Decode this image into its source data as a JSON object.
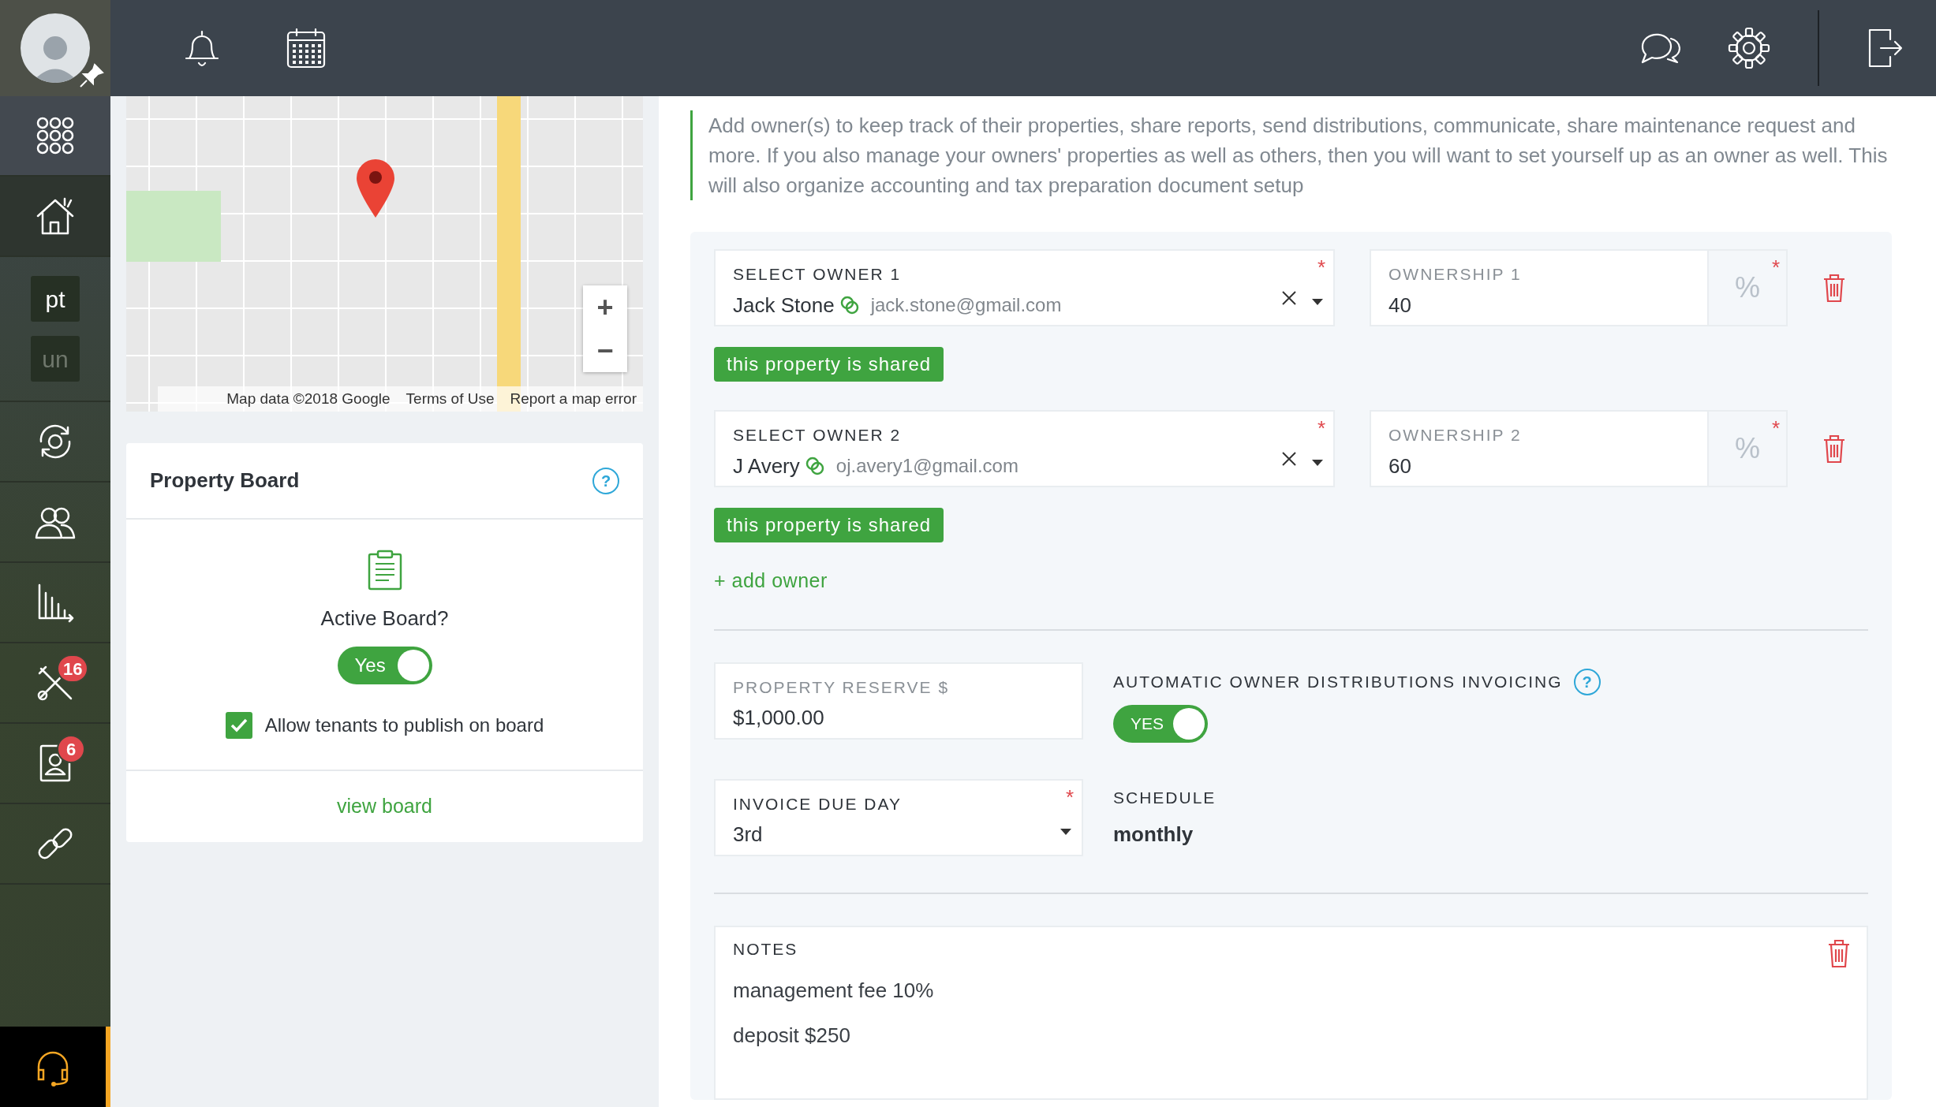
{
  "sidebar": {
    "avatar": {
      "pinned": true
    },
    "items": [
      {
        "kind": "icon",
        "selected": false
      },
      {
        "kind": "icon",
        "selected": true
      },
      {
        "kind": "text",
        "label": "pt",
        "selected": true
      },
      {
        "kind": "text",
        "label": "un",
        "selected": false
      },
      {
        "kind": "icon",
        "selected": false
      },
      {
        "kind": "icon",
        "selected": false
      },
      {
        "kind": "icon",
        "selected": false
      },
      {
        "kind": "icon",
        "selected": false,
        "badge": "16"
      },
      {
        "kind": "icon",
        "selected": false,
        "badge": "6"
      },
      {
        "kind": "icon",
        "selected": false
      }
    ]
  },
  "map": {
    "zoom_in": "+",
    "zoom_out": "−",
    "attribution": [
      "Map data ©2018 Google",
      "Terms of Use",
      "Report a map error"
    ]
  },
  "board": {
    "title": "Property Board",
    "help": "?",
    "question": "Active Board?",
    "toggle": {
      "label": "Yes",
      "on": true
    },
    "checkbox": {
      "label": "Allow tenants to publish on board",
      "checked": true
    },
    "link": "view board"
  },
  "description": "Add owner(s) to keep track of their properties, share reports, send distributions, communicate, share maintenance request and more. If you also manage your owners' properties as well as others, then you will want to set yourself up as an owner as well. This will also organize accounting and tax preparation document setup",
  "owners": [
    {
      "label": "SELECT OWNER 1",
      "required_mark": "*",
      "name": "Jack Stone",
      "email": "jack.stone@gmail.com",
      "ownership_label": "OWNERSHIP 1",
      "ownership": "40",
      "unit": "%",
      "badge": "this property is shared"
    },
    {
      "label": "SELECT OWNER 2",
      "required_mark": "*",
      "name": "J Avery",
      "email": "oj.avery1@gmail.com",
      "ownership_label": "OWNERSHIP 2",
      "ownership": "60",
      "unit": "%",
      "badge": "this property is shared"
    }
  ],
  "add_owner": "+ add owner",
  "reserve": {
    "label": "PROPERTY RESERVE $",
    "value": "$1,000.00"
  },
  "auto_invoicing": {
    "label": "AUTOMATIC OWNER DISTRIBUTIONS INVOICING",
    "help": "?",
    "toggle": {
      "label": "YES",
      "on": true
    }
  },
  "invoice_due_day": {
    "label": "INVOICE DUE DAY",
    "required_mark": "*",
    "value": "3rd"
  },
  "schedule": {
    "label": "SCHEDULE",
    "value": "monthly"
  },
  "notes": {
    "label": "NOTES",
    "lines": [
      "management fee 10%",
      "deposit $250"
    ]
  }
}
